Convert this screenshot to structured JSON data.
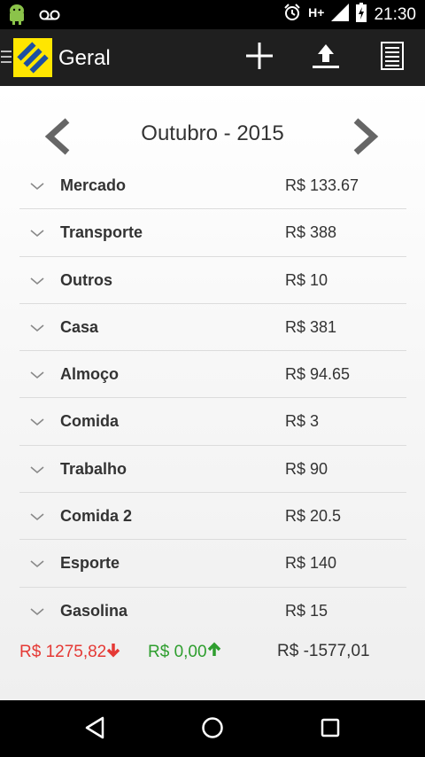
{
  "status": {
    "network": "H+",
    "time": "21:30",
    "voicemail_glyph": "oo"
  },
  "action_bar": {
    "title": "Geral",
    "icons": [
      "drawer-icon",
      "app-logo",
      "add-icon",
      "upload-icon",
      "list-icon"
    ]
  },
  "month": {
    "label": "Outubro - 2015"
  },
  "categories": [
    {
      "name": "Mercado",
      "value": "R$ 133.67"
    },
    {
      "name": "Transporte",
      "value": "R$ 388"
    },
    {
      "name": "Outros",
      "value": "R$ 10"
    },
    {
      "name": "Casa",
      "value": "R$ 381"
    },
    {
      "name": "Almoço",
      "value": "R$ 94.65"
    },
    {
      "name": "Comida",
      "value": "R$ 3"
    },
    {
      "name": "Trabalho",
      "value": "R$ 90"
    },
    {
      "name": "Comida 2",
      "value": "R$ 20.5"
    },
    {
      "name": "Esporte",
      "value": "R$ 140"
    },
    {
      "name": "Gasolina",
      "value": "R$ 15"
    }
  ],
  "totals": {
    "expenses": "R$ 1275,82",
    "income": "R$ 0,00",
    "balance": "R$ -1577,01",
    "colors": {
      "expenses": "#e53935",
      "income": "#2e9e2e"
    }
  }
}
